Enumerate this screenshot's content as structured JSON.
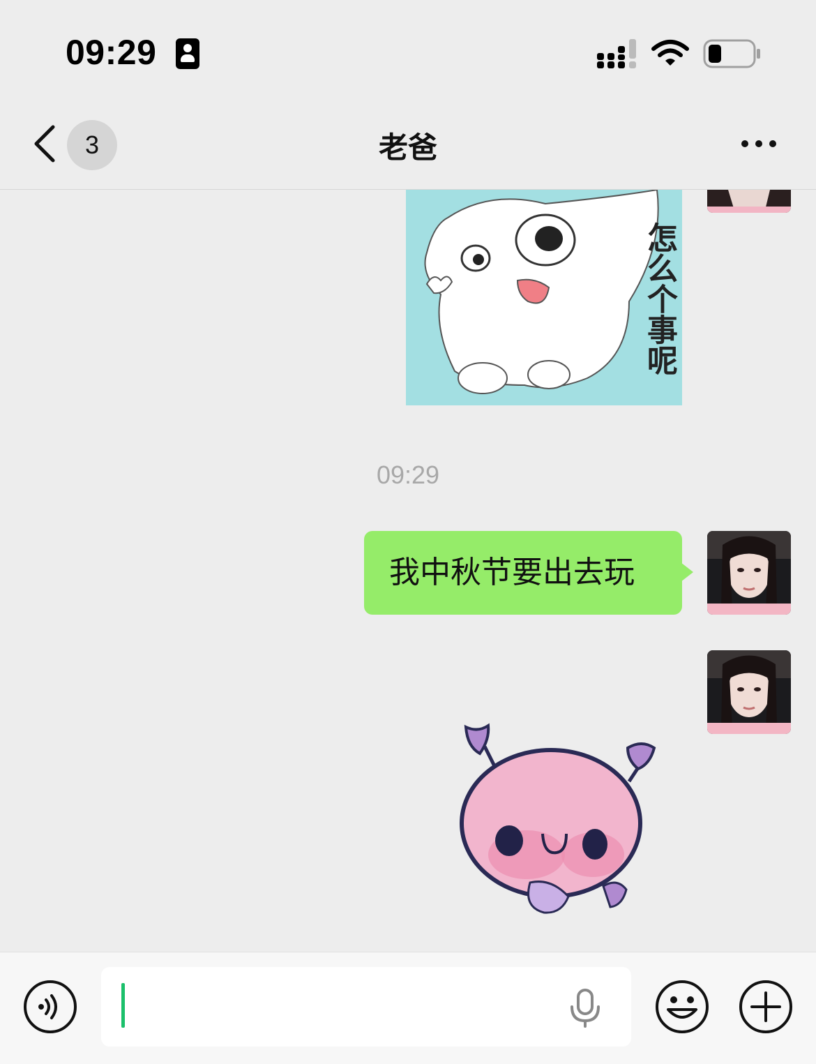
{
  "status_bar": {
    "time": "09:29"
  },
  "nav": {
    "unread_count": "3",
    "title": "老爸"
  },
  "messages": [
    {
      "type": "sticker",
      "caption": "怎么个事呢"
    },
    {
      "type": "timestamp",
      "text": "09:29"
    },
    {
      "type": "text",
      "text": "我中秋节要出去玩"
    },
    {
      "type": "sticker"
    }
  ],
  "input_bar": {
    "value": "",
    "placeholder": ""
  },
  "colors": {
    "bubble_green": "#95ec69",
    "background": "#ededed",
    "caret_green": "#1bc06b"
  }
}
